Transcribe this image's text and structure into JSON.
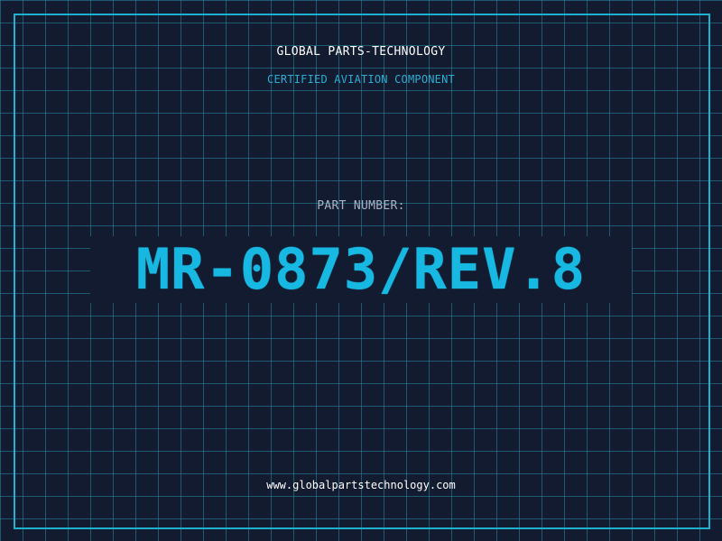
{
  "header": {
    "company_name": "GLOBAL PARTS-TECHNOLOGY",
    "tagline": "CERTIFIED AVIATION COMPONENT"
  },
  "part": {
    "label": "PART NUMBER:",
    "number": "MR-0873/REV.8"
  },
  "footer": {
    "website": "www.globalpartstechnology.com"
  },
  "colors": {
    "background": "#131b30",
    "grid": "#288ca5",
    "accent": "#17b8e2",
    "text_primary": "#ffffff",
    "text_muted": "#a9b3c6"
  }
}
